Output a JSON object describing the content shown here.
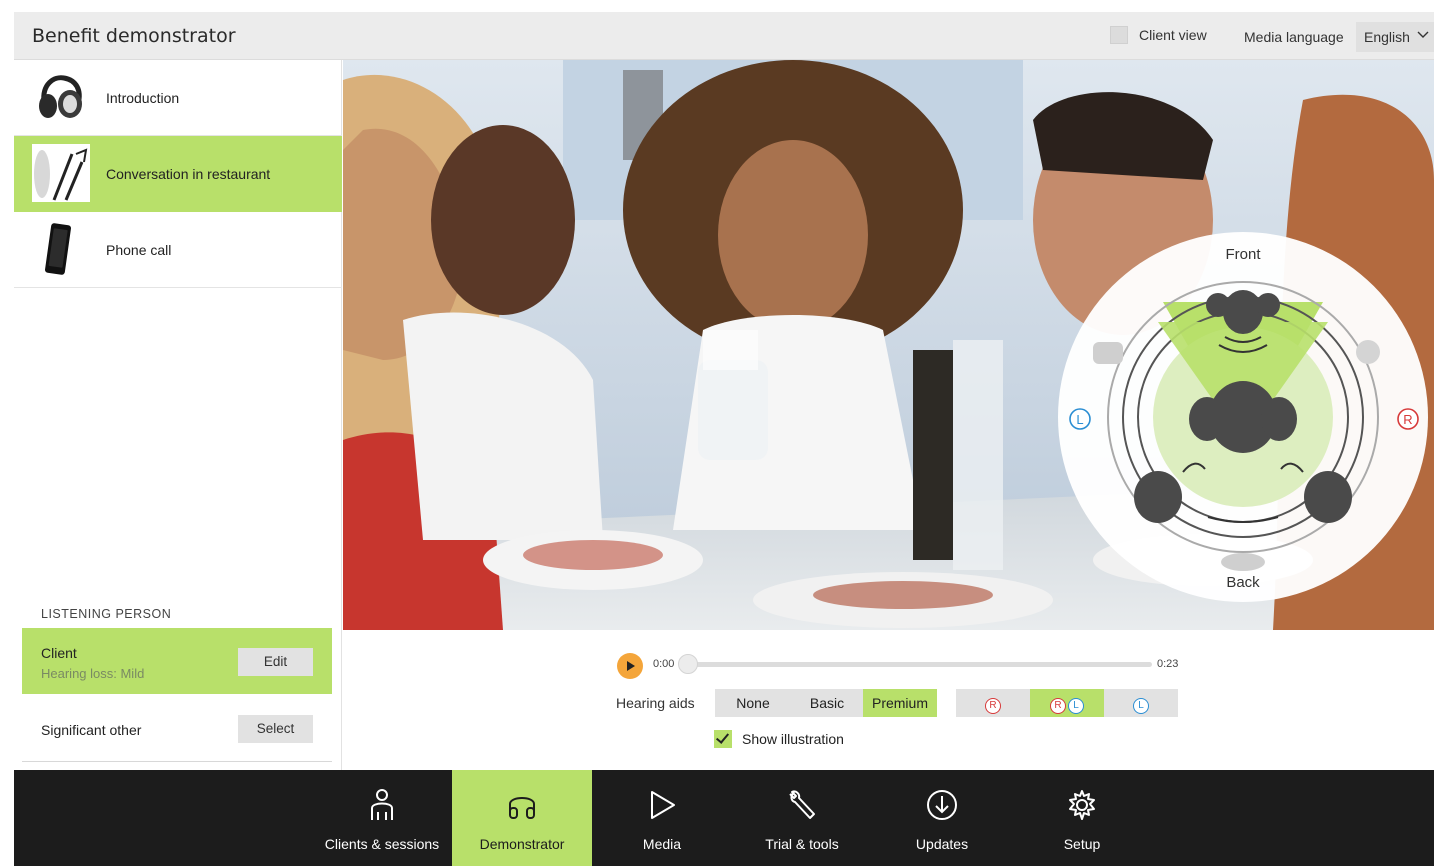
{
  "header": {
    "title": "Benefit demonstrator",
    "client_view_label": "Client view",
    "media_language_label": "Media language",
    "media_language_value": "English"
  },
  "scenes": [
    {
      "label": "Introduction",
      "icon": "headphones-icon",
      "active": false
    },
    {
      "label": "Conversation in restaurant",
      "icon": "cutlery-icon",
      "active": true
    },
    {
      "label": "Phone call",
      "icon": "phone-icon",
      "active": false
    }
  ],
  "listening_person": {
    "heading": "LISTENING PERSON",
    "client": {
      "name": "Client",
      "description": "Hearing loss: Mild",
      "button": "Edit"
    },
    "other": {
      "name": "Significant other",
      "button": "Select"
    }
  },
  "illustration": {
    "front_label": "Front",
    "back_label": "Back",
    "left_ear": "L",
    "right_ear": "R"
  },
  "player": {
    "time_current": "0:00",
    "time_total": "0:23",
    "progress": 0.0
  },
  "hearing_aids": {
    "label": "Hearing aids",
    "levels": [
      "None",
      "Basic",
      "Premium"
    ],
    "selected_level": "Premium",
    "sides": [
      "R",
      "RL",
      "L"
    ],
    "selected_side": "RL",
    "ear_right": "R",
    "ear_left": "L"
  },
  "show_illustration": {
    "label": "Show illustration",
    "checked": true
  },
  "nav": [
    {
      "label": "Clients & sessions",
      "icon": "person-icon"
    },
    {
      "label": "Demonstrator",
      "icon": "headphones-icon",
      "active": true
    },
    {
      "label": "Media",
      "icon": "play-icon"
    },
    {
      "label": "Trial & tools",
      "icon": "wrench-icon"
    },
    {
      "label": "Updates",
      "icon": "download-icon"
    },
    {
      "label": "Setup",
      "icon": "gear-icon"
    }
  ],
  "colors": {
    "accent": "#b8e06a",
    "play": "#f4a53a",
    "right_ear": "#d73a3a",
    "left_ear": "#2b8ed3",
    "navbar": "#1c1c1c"
  }
}
